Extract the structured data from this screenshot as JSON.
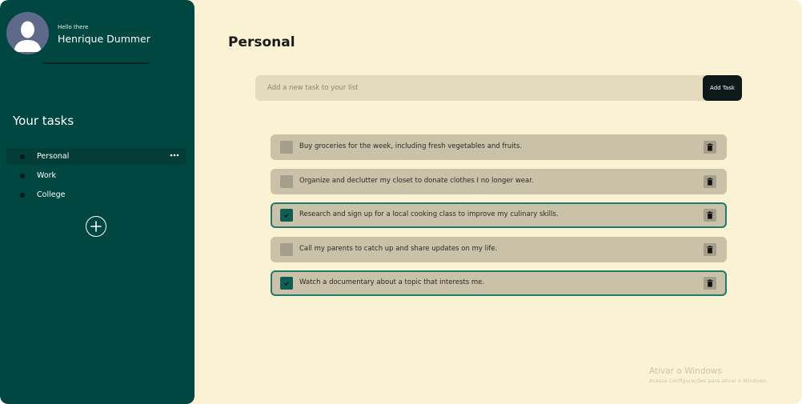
{
  "profile": {
    "greeting": "Hello there",
    "name": "Henrique Dummer"
  },
  "sidebar": {
    "heading": "Your tasks",
    "lists": [
      {
        "label": "Personal",
        "active": true
      },
      {
        "label": "Work",
        "active": false
      },
      {
        "label": "College",
        "active": false
      }
    ],
    "more_icon": "more-horizontal-icon",
    "add_icon": "plus-circle-icon"
  },
  "main": {
    "title": "Personal",
    "input": {
      "placeholder": "Add a new task to your list",
      "value": ""
    },
    "add_button_label": "Add Task",
    "tasks": [
      {
        "text": "Buy groceries for the week, including fresh vegetables and fruits.",
        "done": false
      },
      {
        "text": "Organize and declutter my closet to donate clothes I no longer wear.",
        "done": false
      },
      {
        "text": "Research and sign up for a local cooking class to improve my culinary skills.",
        "done": true
      },
      {
        "text": "Call my parents to catch up and share updates on my life.",
        "done": false
      },
      {
        "text": "Watch a documentary about a topic that interests me.",
        "done": true
      }
    ]
  },
  "watermark": {
    "title": "Ativar o Windows",
    "subtitle": "Acesse Configurações para ativar o Windows."
  },
  "colors": {
    "sidebar": "#004741",
    "background": "#faf3d3",
    "task": "#c9c2a8",
    "accent": "#1f7a6a"
  }
}
